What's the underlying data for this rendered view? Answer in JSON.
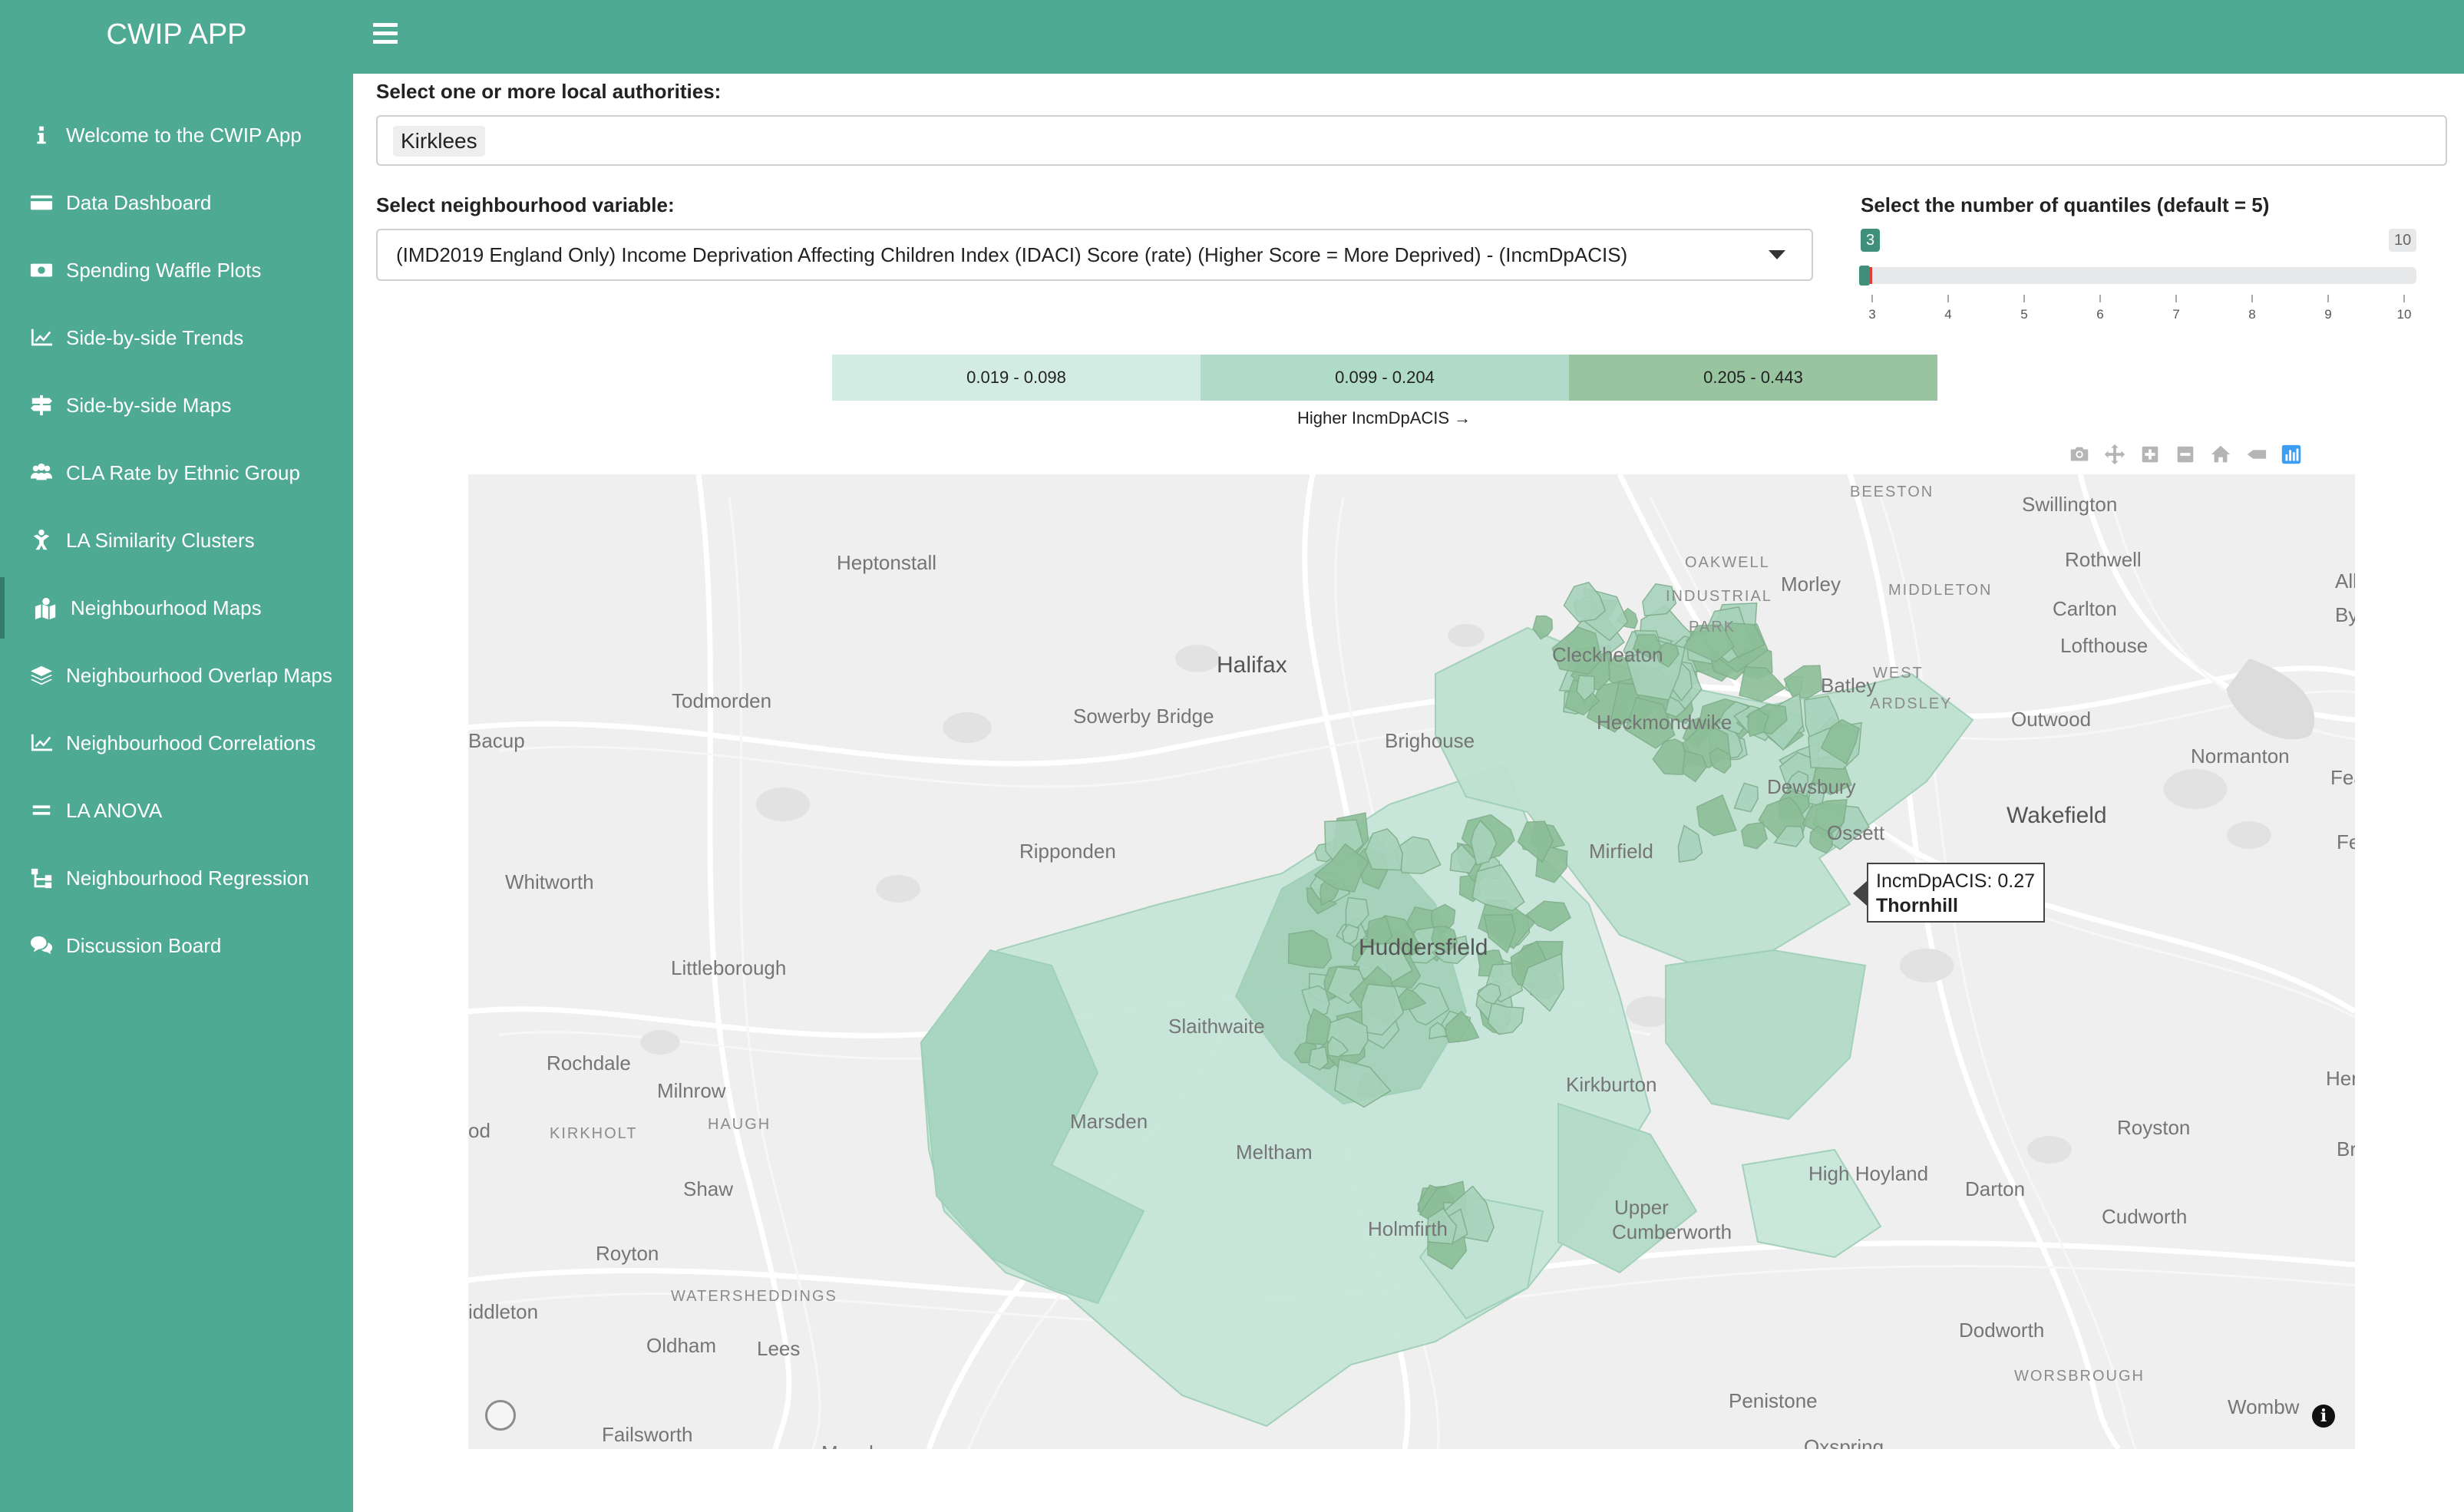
{
  "app": {
    "title": "CWIP APP"
  },
  "sidebar": {
    "items": [
      {
        "label": "Welcome to the CWIP App",
        "icon": "info-icon"
      },
      {
        "label": "Data Dashboard",
        "icon": "card-icon"
      },
      {
        "label": "Spending Waffle Plots",
        "icon": "money-icon"
      },
      {
        "label": "Side-by-side Trends",
        "icon": "line-chart-icon"
      },
      {
        "label": "Side-by-side Maps",
        "icon": "signpost-icon"
      },
      {
        "label": "CLA Rate by Ethnic Group",
        "icon": "users-icon"
      },
      {
        "label": "LA Similarity Clusters",
        "icon": "child-icon"
      },
      {
        "label": "Neighbourhood Maps",
        "icon": "map-marked-icon",
        "active": true
      },
      {
        "label": "Neighbourhood Overlap Maps",
        "icon": "layers-icon"
      },
      {
        "label": "Neighbourhood Correlations",
        "icon": "line-chart-icon"
      },
      {
        "label": "LA ANOVA",
        "icon": "equals-icon"
      },
      {
        "label": "Neighbourhood Regression",
        "icon": "sitemap-icon"
      },
      {
        "label": "Discussion Board",
        "icon": "comments-icon"
      }
    ]
  },
  "filters": {
    "la_label": "Select one or more local authorities:",
    "la_selected": "Kirklees",
    "variable_label": "Select neighbourhood variable:",
    "variable_selected": "(IMD2019 England Only) Income Deprivation Affecting Children Index (IDACI) Score (rate) (Higher Score = More Deprived) - (IncmDpACIS)",
    "quantiles_label": "Select the number of quantiles (default = 5)",
    "quantiles_value": "3",
    "quantiles_max": "10",
    "quantiles_min": 3,
    "quantiles_ticks": [
      "3",
      "4",
      "5",
      "6",
      "7",
      "8",
      "9",
      "10"
    ]
  },
  "legend": {
    "bins": [
      {
        "label": "0.019 - 0.098",
        "color": "#d2ebe3"
      },
      {
        "label": "0.099 - 0.204",
        "color": "#b0dbc8"
      },
      {
        "label": "0.205 - 0.443",
        "color": "#98c5a0"
      }
    ],
    "caption": "Higher IncmDpACIS →"
  },
  "modebar": [
    "camera-icon",
    "pan-icon",
    "zoom-in-icon",
    "zoom-out-icon",
    "home-icon",
    "hover-closest-icon",
    "plotly-logo-icon"
  ],
  "map": {
    "places": [
      {
        "name": "BEESTON",
        "cls": "small"
      },
      {
        "name": "Swillington",
        "cls": ""
      },
      {
        "name": "Heptonstall",
        "cls": ""
      },
      {
        "name": "Rothwell",
        "cls": ""
      },
      {
        "name": "Morley",
        "cls": ""
      },
      {
        "name": "MIDDLETON",
        "cls": "small"
      },
      {
        "name": "OAKWELL",
        "cls": "small"
      },
      {
        "name": "INDUSTRIAL",
        "cls": "small"
      },
      {
        "name": "PARK",
        "cls": "small"
      },
      {
        "name": "Carlton",
        "cls": ""
      },
      {
        "name": "Lofthouse",
        "cls": ""
      },
      {
        "name": "Halifax",
        "cls": "big"
      },
      {
        "name": "Cleckheaton",
        "cls": ""
      },
      {
        "name": "Todmorden",
        "cls": ""
      },
      {
        "name": "Batley",
        "cls": ""
      },
      {
        "name": "WEST",
        "cls": "small"
      },
      {
        "name": "ARDSLEY",
        "cls": "small"
      },
      {
        "name": "Sowerby Bridge",
        "cls": ""
      },
      {
        "name": "Heckmondwike",
        "cls": ""
      },
      {
        "name": "Outwood",
        "cls": ""
      },
      {
        "name": "Bacup",
        "cls": ""
      },
      {
        "name": "Brighouse",
        "cls": ""
      },
      {
        "name": "Normanton",
        "cls": ""
      },
      {
        "name": "Dewsbury",
        "cls": ""
      },
      {
        "name": "Wakefield",
        "cls": "big"
      },
      {
        "name": "Ossett",
        "cls": ""
      },
      {
        "name": "Ripponden",
        "cls": ""
      },
      {
        "name": "Mirfield",
        "cls": ""
      },
      {
        "name": "Whitworth",
        "cls": ""
      },
      {
        "name": "Littleborough",
        "cls": ""
      },
      {
        "name": "Huddersfield",
        "cls": "big"
      },
      {
        "name": "Slaithwaite",
        "cls": ""
      },
      {
        "name": "Rochdale",
        "cls": ""
      },
      {
        "name": "Milnrow",
        "cls": ""
      },
      {
        "name": "Kirkburton",
        "cls": ""
      },
      {
        "name": "KIRKHOLT",
        "cls": "small"
      },
      {
        "name": "HAUGH",
        "cls": "small"
      },
      {
        "name": "Marsden",
        "cls": ""
      },
      {
        "name": "Royston",
        "cls": ""
      },
      {
        "name": "Meltham",
        "cls": ""
      },
      {
        "name": "High Hoyland",
        "cls": ""
      },
      {
        "name": "Shaw",
        "cls": ""
      },
      {
        "name": "Darton",
        "cls": ""
      },
      {
        "name": "Upper",
        "cls": ""
      },
      {
        "name": "Cumberworth",
        "cls": ""
      },
      {
        "name": "Holmfirth",
        "cls": ""
      },
      {
        "name": "Royton",
        "cls": ""
      },
      {
        "name": "Cudworth",
        "cls": ""
      },
      {
        "name": "WATERSHEDDINGS",
        "cls": "small"
      },
      {
        "name": "Oldham",
        "cls": ""
      },
      {
        "name": "Lees",
        "cls": ""
      },
      {
        "name": "Dodworth",
        "cls": ""
      },
      {
        "name": "WORSBROUGH",
        "cls": "small"
      },
      {
        "name": "Penistone",
        "cls": ""
      },
      {
        "name": "Failsworth",
        "cls": ""
      },
      {
        "name": "Oxspring",
        "cls": ""
      },
      {
        "name": "Wombw",
        "cls": ""
      },
      {
        "name": "Her",
        "cls": ""
      },
      {
        "name": "Brierley",
        "cls": ""
      },
      {
        "name": "Feat",
        "cls": ""
      },
      {
        "name": "Featl",
        "cls": ""
      },
      {
        "name": "Alle",
        "cls": ""
      },
      {
        "name": "Byw",
        "cls": ""
      },
      {
        "name": "od",
        "cls": ""
      },
      {
        "name": "iddleton",
        "cls": ""
      },
      {
        "name": "Mossley",
        "cls": ""
      }
    ],
    "tooltip": {
      "value_text": "IncmDpACIS: 0.27",
      "area": "Thornhill"
    }
  }
}
